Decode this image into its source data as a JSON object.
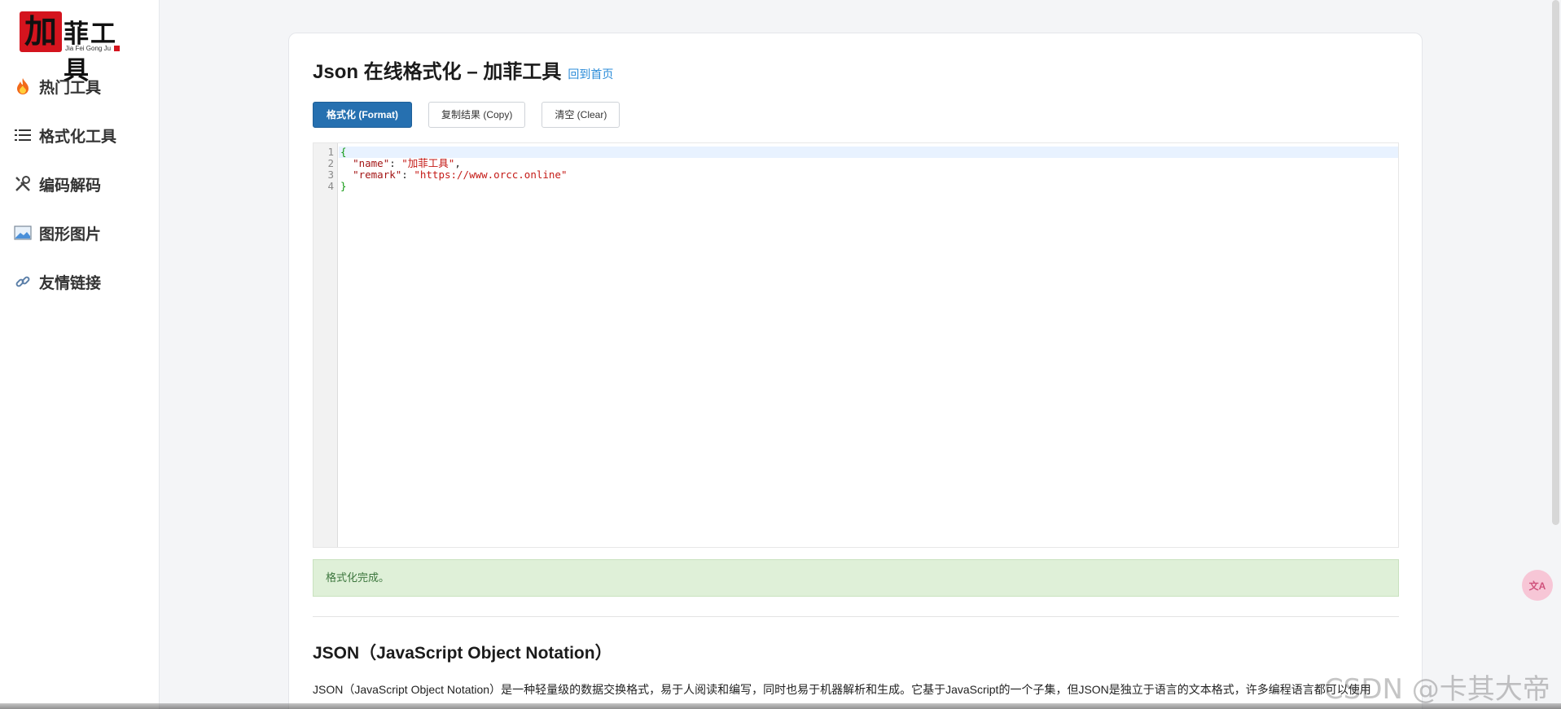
{
  "sidebar": {
    "logo": {
      "seal_char": "加",
      "brand": "菲工具",
      "sub": "Jia Fei Gong Ju"
    },
    "items": [
      {
        "label": "热门工具",
        "icon": "fire-icon"
      },
      {
        "label": "格式化工具",
        "icon": "list-icon"
      },
      {
        "label": "编码解码",
        "icon": "tools-icon"
      },
      {
        "label": "图形图片",
        "icon": "image-icon"
      },
      {
        "label": "友情链接",
        "icon": "link-icon"
      }
    ]
  },
  "main": {
    "title": "Json 在线格式化 – 加菲工具",
    "home_link": "回到首页",
    "buttons": {
      "format": "格式化 (Format)",
      "copy": "复制结果 (Copy)",
      "clear": "清空 (Clear)"
    },
    "editor": {
      "line_numbers": [
        "1",
        "2",
        "3",
        "4"
      ],
      "lines": {
        "l1": "{",
        "l2_key": "\"name\"",
        "l2_sep": ": ",
        "l2_val": "\"加菲工具\"",
        "l2_end": ",",
        "l3_key": "\"remark\"",
        "l3_sep": ": ",
        "l3_val": "\"https://www.orcc.online\"",
        "l4": "}"
      }
    },
    "status": "格式化完成。",
    "section_title": "JSON（JavaScript Object Notation）",
    "section_text": "JSON（JavaScript Object Notation）是一种轻量级的数据交换格式，易于人阅读和编写，同时也易于机器解析和生成。它基于JavaScript的一个子集，但JSON是独立于语言的文本格式，许多编程语言都可以使用"
  },
  "overlay": {
    "translate_label": "文A",
    "watermark": "CSDN @卡其大帝"
  },
  "colors": {
    "primary_button": "#2670b0",
    "link": "#2a8bd8",
    "success_bg": "#dff0d8",
    "success_text": "#3c763d"
  }
}
